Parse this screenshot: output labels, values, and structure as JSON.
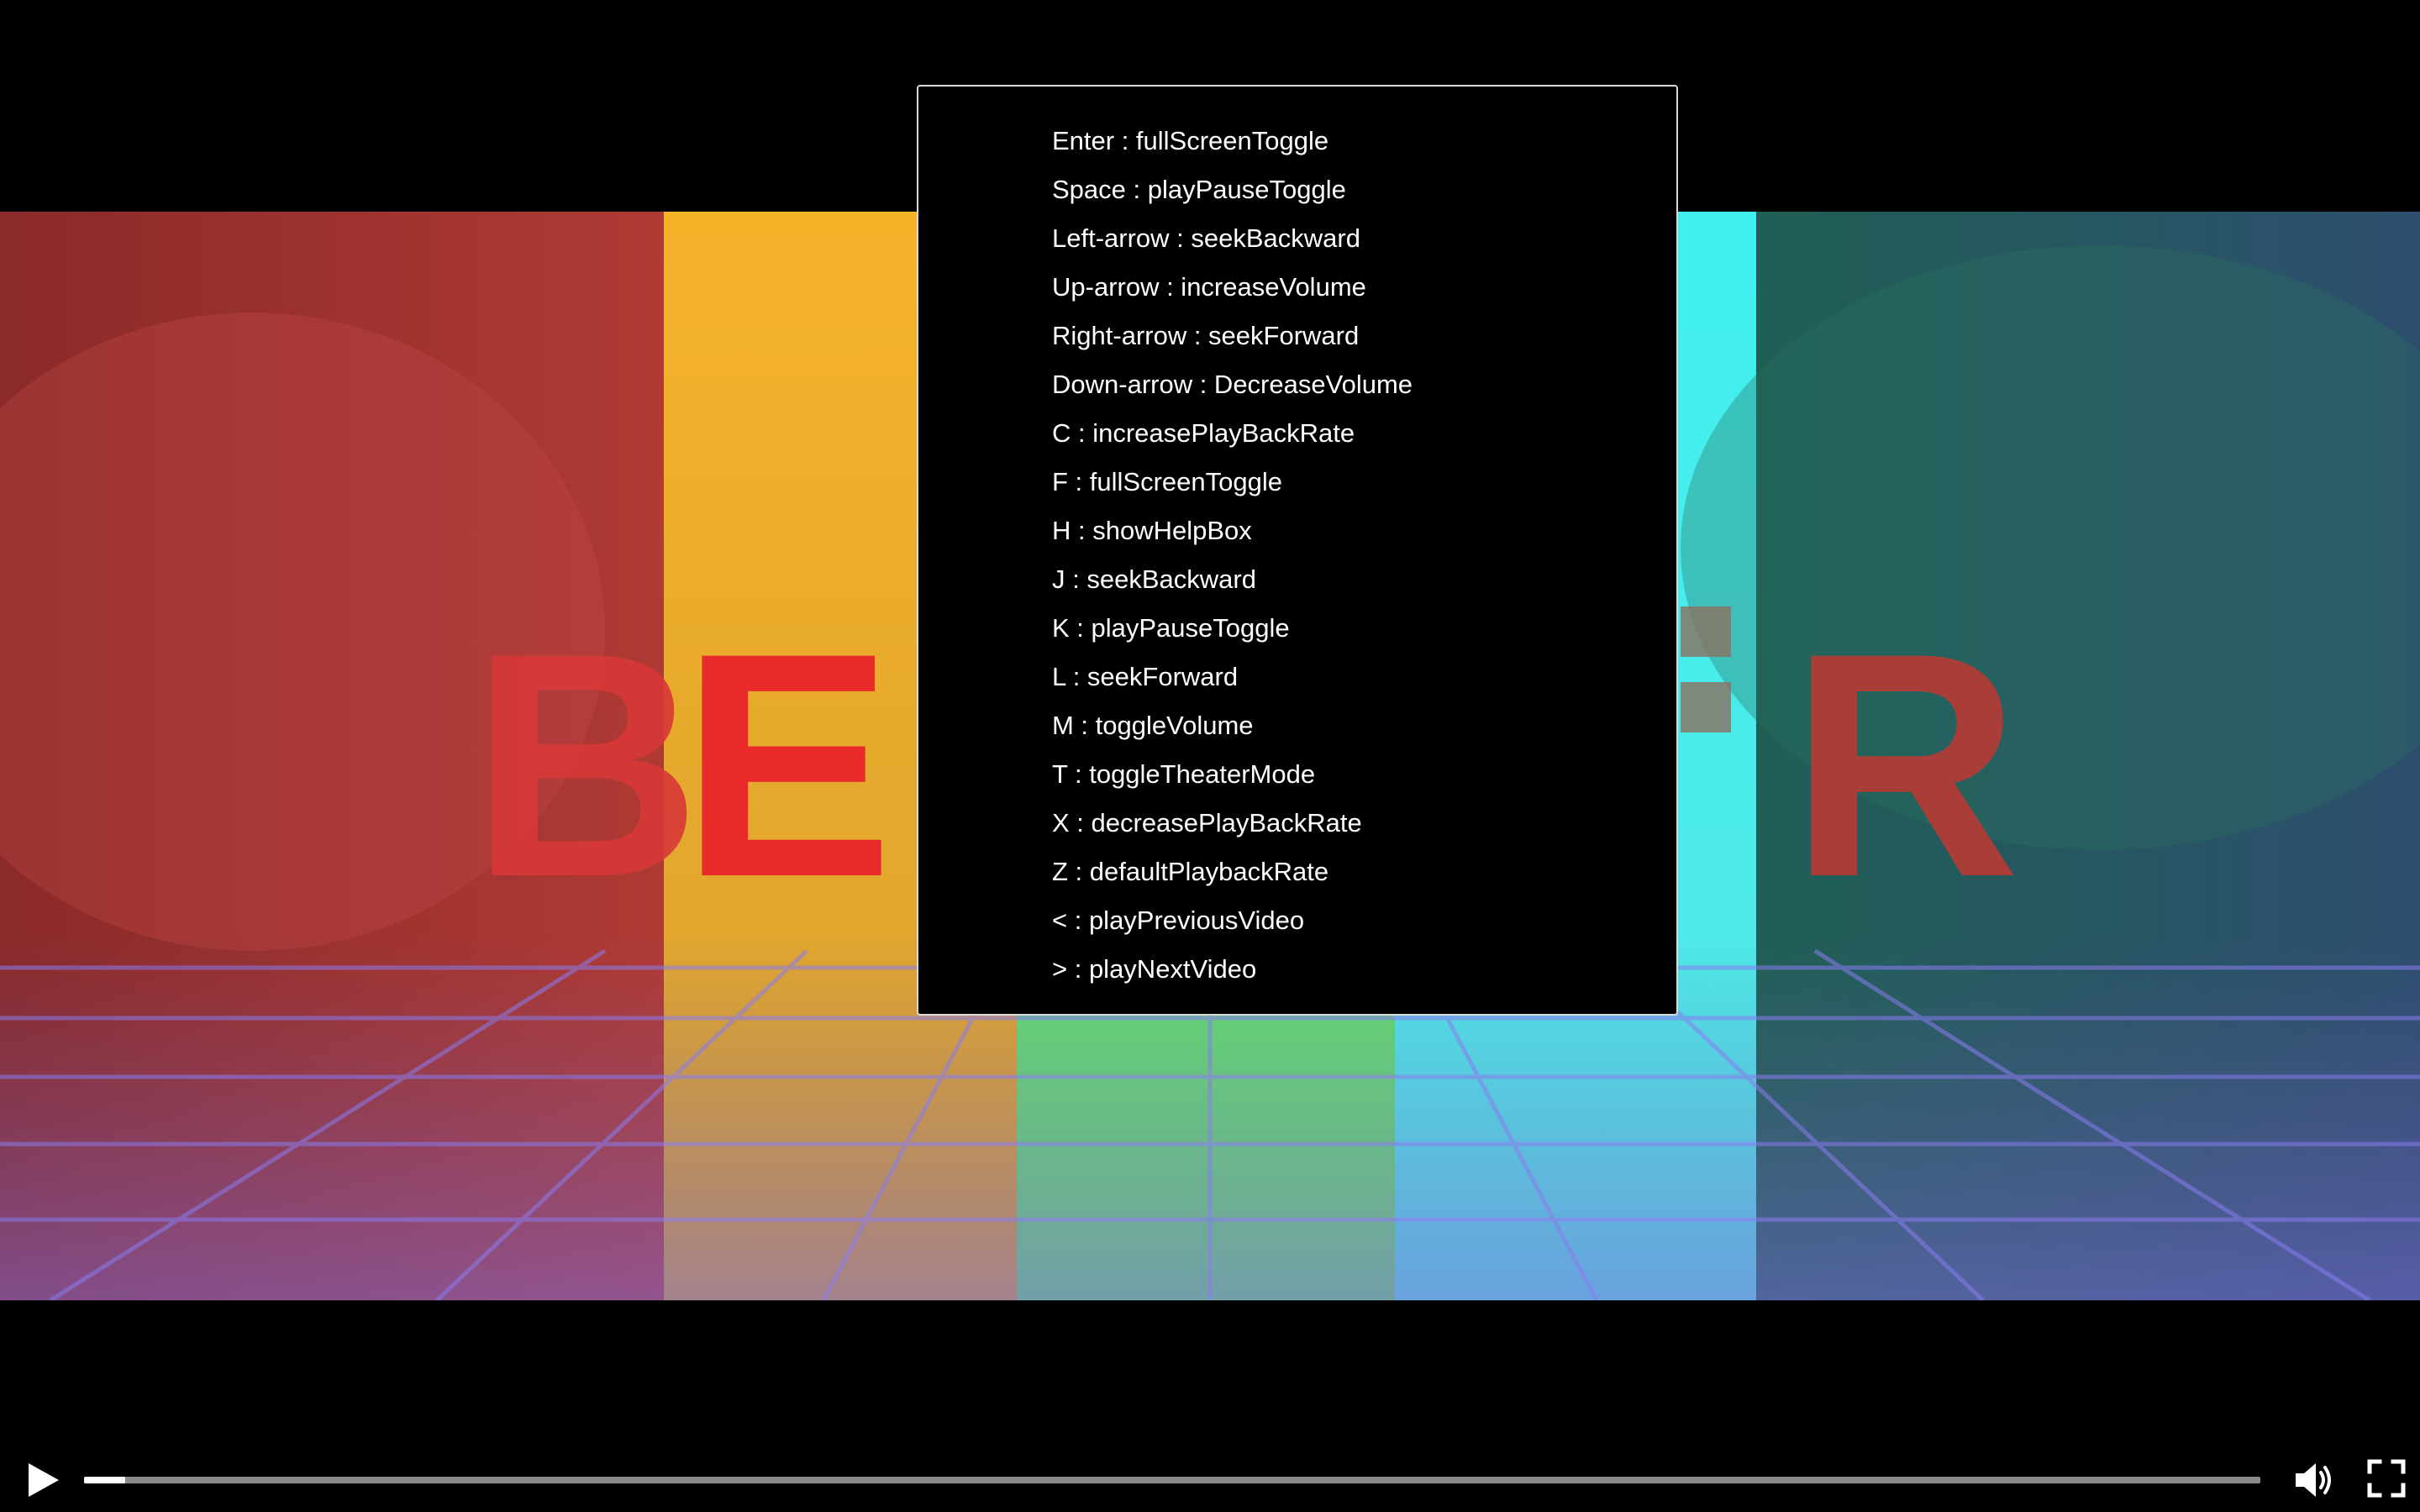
{
  "help_box": {
    "shortcuts": [
      "Enter : fullScreenToggle",
      "Space : playPauseToggle",
      "Left-arrow : seekBackward",
      "Up-arrow : increaseVolume",
      "Right-arrow : seekForward",
      "Down-arrow : DecreaseVolume",
      "C : increasePlayBackRate",
      "F : fullScreenToggle",
      "H : showHelpBox",
      "J : seekBackward",
      "K : playPauseToggle",
      "L : seekForward",
      "M : toggleVolume",
      "T : toggleTheaterMode",
      "X : decreasePlayBackRate",
      "Z : defaultPlaybackRate",
      "< : playPreviousVideo",
      "> : playNextVideo"
    ]
  },
  "controls": {
    "play_icon": "play-icon",
    "volume_icon": "volume-high-icon",
    "fullscreen_icon": "fullscreen-icon",
    "progress_fraction": 0.019
  },
  "colors": {
    "progress_fill": "#ffffff",
    "progress_track": "#8a8a8a",
    "help_border": "#d9d9d9"
  }
}
